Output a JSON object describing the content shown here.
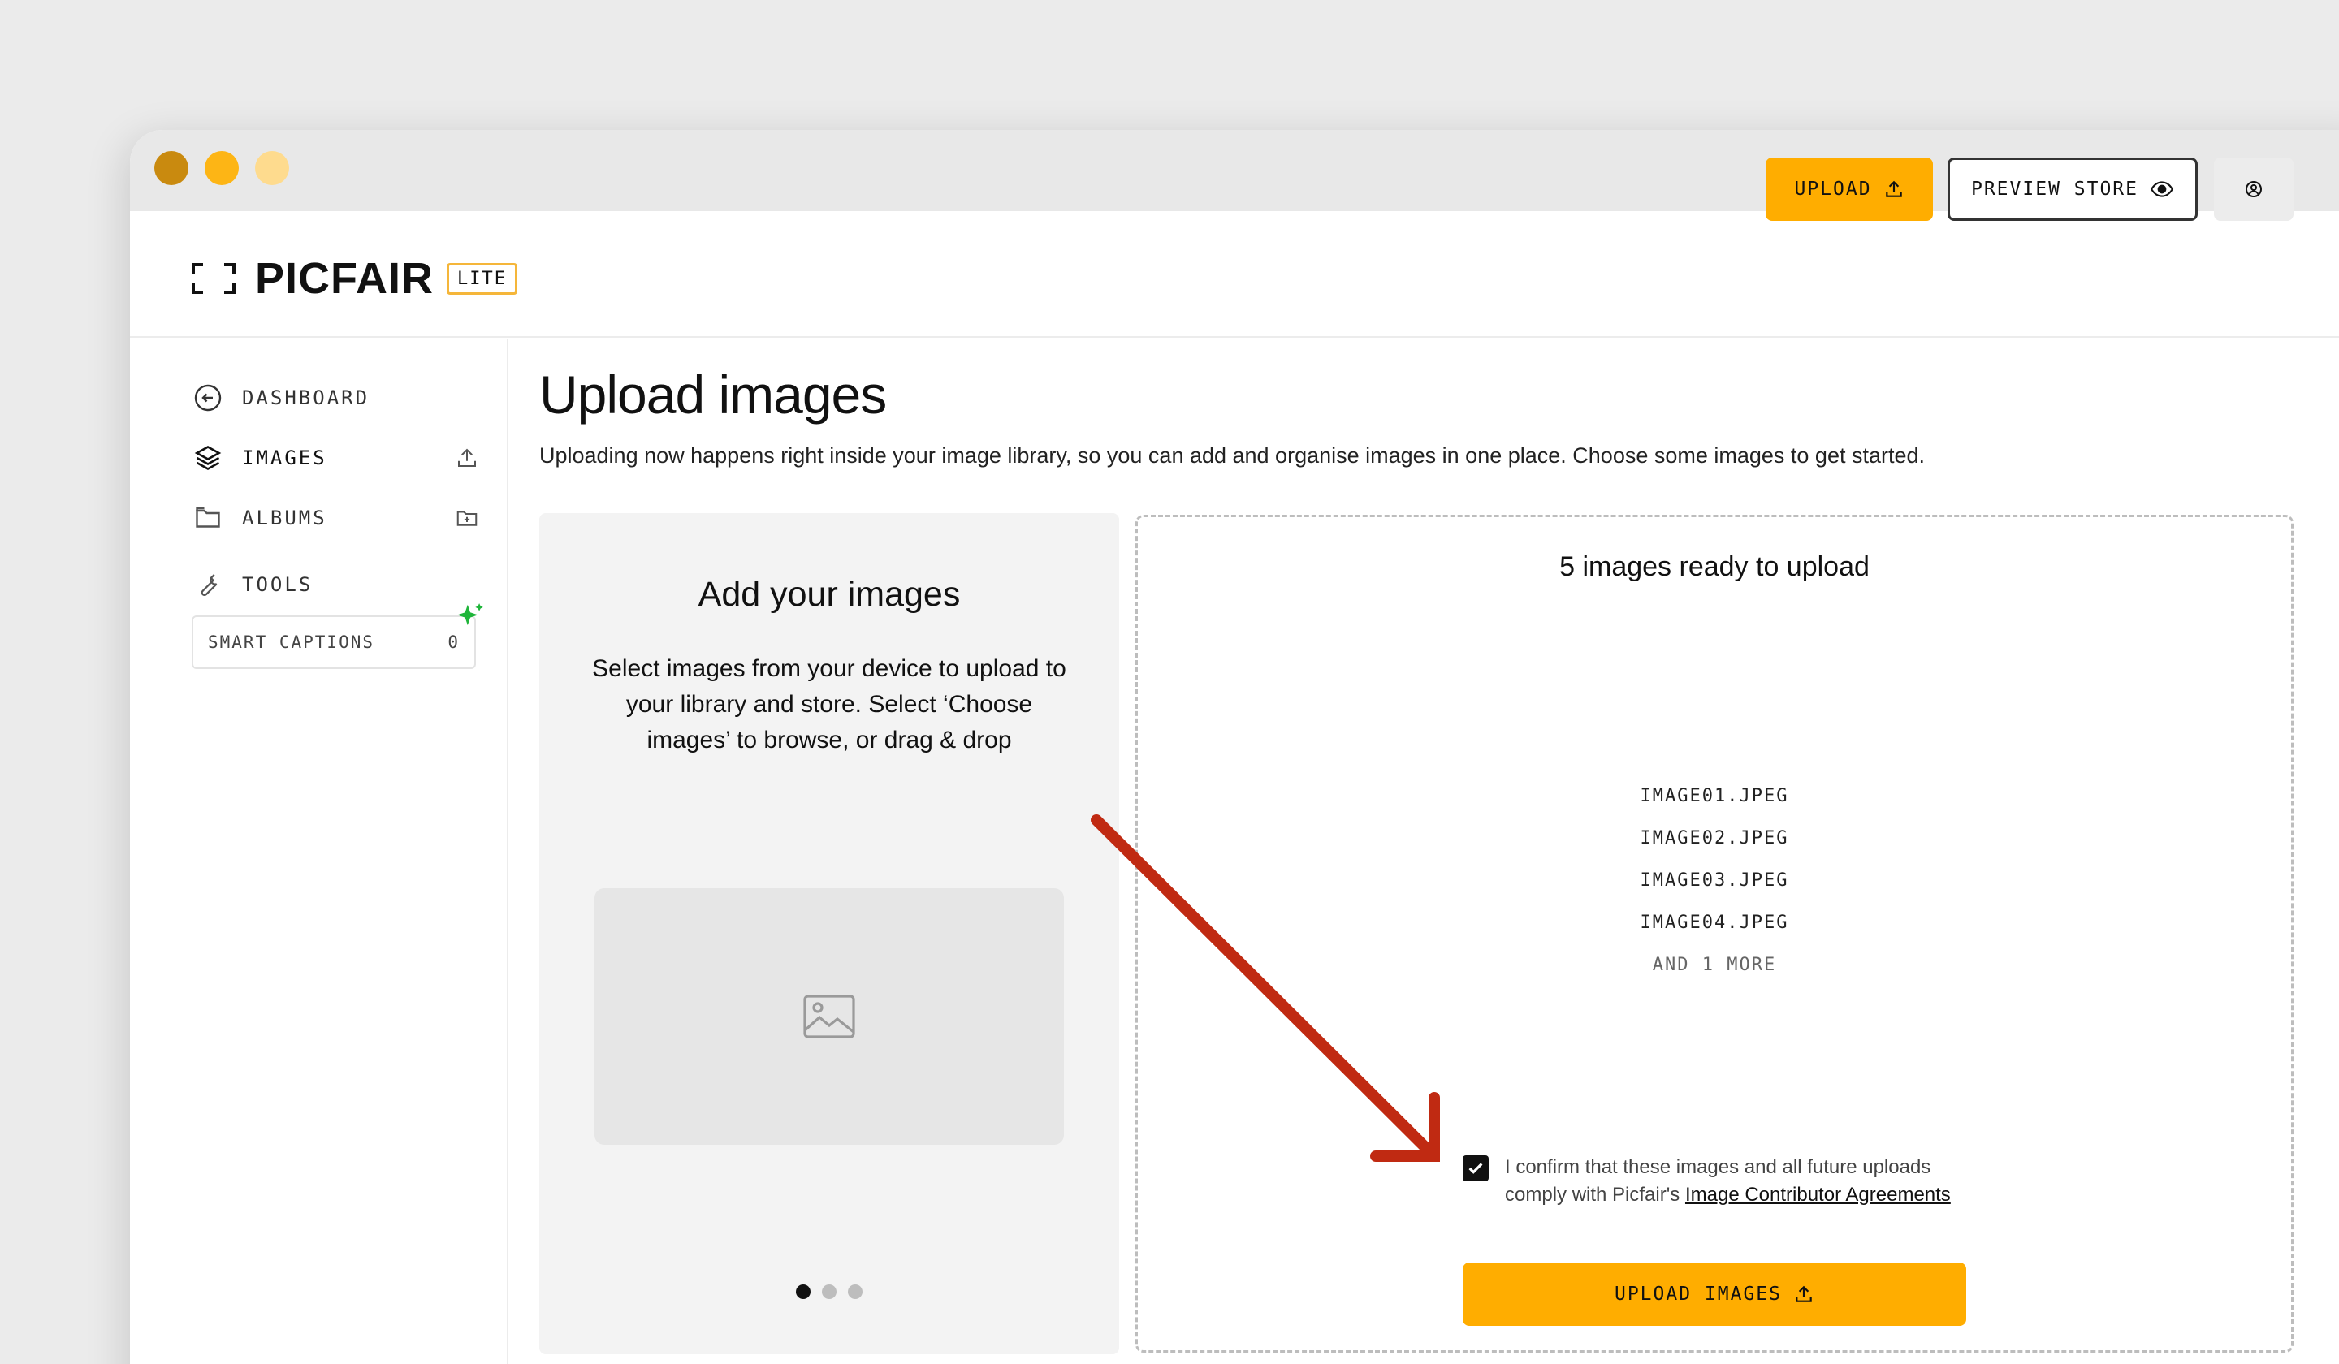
{
  "header": {
    "logo_text": "PICFAIR",
    "badge": "LITE",
    "upload_label": "UPLOAD",
    "preview_label": "PREVIEW STORE"
  },
  "sidebar": {
    "items": [
      {
        "label": "DASHBOARD",
        "icon": "arrow-left-circle-icon"
      },
      {
        "label": "IMAGES",
        "icon": "layers-icon"
      },
      {
        "label": "ALBUMS",
        "icon": "folder-icon"
      },
      {
        "label": "TOOLS",
        "icon": "wrench-icon"
      }
    ],
    "captions": {
      "label": "SMART CAPTIONS",
      "count": "0"
    }
  },
  "main": {
    "title": "Upload images",
    "description": "Uploading now happens right inside your image library, so you can add and organise images in one place. Choose some images to get started."
  },
  "add_panel": {
    "title": "Add your images",
    "text": "Select images from your device to upload to your library and store. Select ‘Choose images’ to browse, or drag & drop",
    "carousel_active": 1,
    "carousel_total": 3
  },
  "ready_panel": {
    "title": "5 images ready to upload",
    "files": [
      "IMAGE01.JPEG",
      "IMAGE02.JPEG",
      "IMAGE03.JPEG",
      "IMAGE04.JPEG"
    ],
    "more": "AND 1 MORE",
    "confirm_text": "I confirm that these images and all future uploads comply with Picfair's",
    "confirm_link": "Image Contributor Agreements",
    "confirm_checked": true,
    "upload_button": "UPLOAD IMAGES"
  },
  "colors": {
    "accent": "#ffad00",
    "annotation_arrow": "#c02a12",
    "sparkle": "#1fb53a"
  }
}
